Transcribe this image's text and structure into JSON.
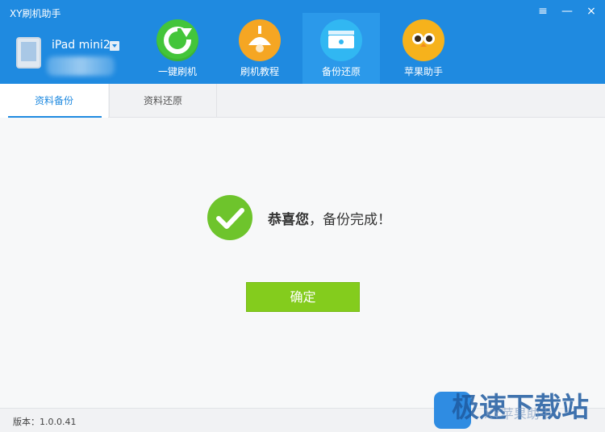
{
  "window": {
    "title": "XY刷机助手",
    "controls": [
      {
        "name": "menu-icon",
        "glyph": "≡"
      },
      {
        "name": "minimize-icon",
        "glyph": "—"
      },
      {
        "name": "close-icon",
        "glyph": "×"
      }
    ]
  },
  "device": {
    "name": "iPad mini2",
    "icon": "ipad-icon"
  },
  "nav": [
    {
      "id": "one-click-flash",
      "label": "一键刷机",
      "icon": "refresh-icon",
      "color": "#43c53a"
    },
    {
      "id": "flash-tutorial",
      "label": "刷机教程",
      "icon": "lamp-icon",
      "color": "#f5a623"
    },
    {
      "id": "backup-restore",
      "label": "备份还原",
      "icon": "drive-icon",
      "color": "#31b7f2",
      "active": true
    },
    {
      "id": "apple-helper",
      "label": "苹果助手",
      "icon": "owl-icon",
      "color": "#f6b21c"
    }
  ],
  "tabs": [
    {
      "label": "资料备份",
      "active": true
    },
    {
      "label": "资料还原",
      "active": false
    }
  ],
  "success": {
    "strong": "恭喜您",
    "rest": "，备份完成！",
    "icon": "check-icon"
  },
  "button": {
    "label": "确定"
  },
  "footer": {
    "version": "版本：1.0.0.41"
  },
  "watermark": {
    "text": "极速下载站",
    "sub": "XY苹果助手"
  },
  "colors": {
    "header": "#1f8ae0",
    "accent_green": "#84cc1d",
    "success_green": "#6ec42c"
  }
}
